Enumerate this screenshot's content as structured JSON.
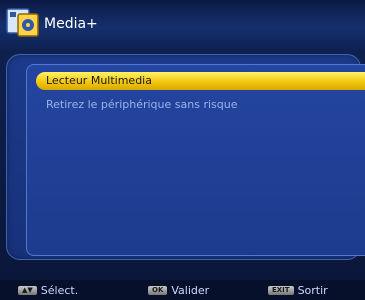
{
  "header": {
    "title": "Media+",
    "icon": "media-plus-icon"
  },
  "menu": {
    "items": [
      {
        "label": "Lecteur Multimedia"
      },
      {
        "label": "Retirez le périphérique sans risque"
      }
    ]
  },
  "footer": {
    "select_label": "Sélect.",
    "ok_key": "OK",
    "ok_label": "Valider",
    "exit_key": "EXIT",
    "exit_label": "Sortir"
  }
}
